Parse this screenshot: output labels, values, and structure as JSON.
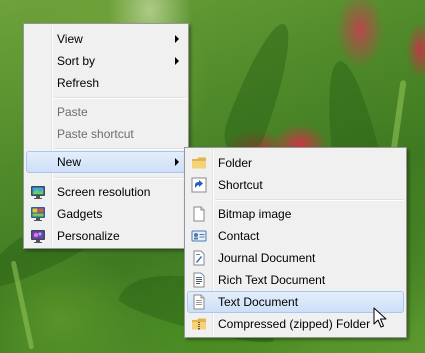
{
  "desktop_menu": {
    "items": [
      {
        "label": "View",
        "has_submenu": true,
        "disabled": false
      },
      {
        "label": "Sort by",
        "has_submenu": true,
        "disabled": false
      },
      {
        "label": "Refresh",
        "has_submenu": false,
        "disabled": false
      },
      {
        "label": "Paste",
        "has_submenu": false,
        "disabled": true
      },
      {
        "label": "Paste shortcut",
        "has_submenu": false,
        "disabled": true
      },
      {
        "label": "New",
        "has_submenu": true,
        "disabled": false,
        "highlighted": true
      },
      {
        "label": "Screen resolution",
        "icon": "monitor-icon",
        "disabled": false
      },
      {
        "label": "Gadgets",
        "icon": "gadgets-icon",
        "disabled": false
      },
      {
        "label": "Personalize",
        "icon": "personalize-icon",
        "disabled": false
      }
    ]
  },
  "new_submenu": {
    "items": [
      {
        "label": "Folder",
        "icon": "folder-icon"
      },
      {
        "label": "Shortcut",
        "icon": "shortcut-icon"
      },
      {
        "label": "Bitmap image",
        "icon": "bitmap-icon"
      },
      {
        "label": "Contact",
        "icon": "contact-icon"
      },
      {
        "label": "Journal Document",
        "icon": "journal-icon"
      },
      {
        "label": "Rich Text Document",
        "icon": "rich-text-icon"
      },
      {
        "label": "Text Document",
        "icon": "text-document-icon",
        "highlighted": true
      },
      {
        "label": "Compressed (zipped) Folder",
        "icon": "zip-folder-icon"
      }
    ]
  },
  "colors": {
    "menu_background": "#f0f0f0",
    "menu_border": "#979797",
    "highlight_fill": "#cddff7",
    "highlight_border": "#a8c8ef",
    "disabled_text": "#6d6d6d"
  }
}
